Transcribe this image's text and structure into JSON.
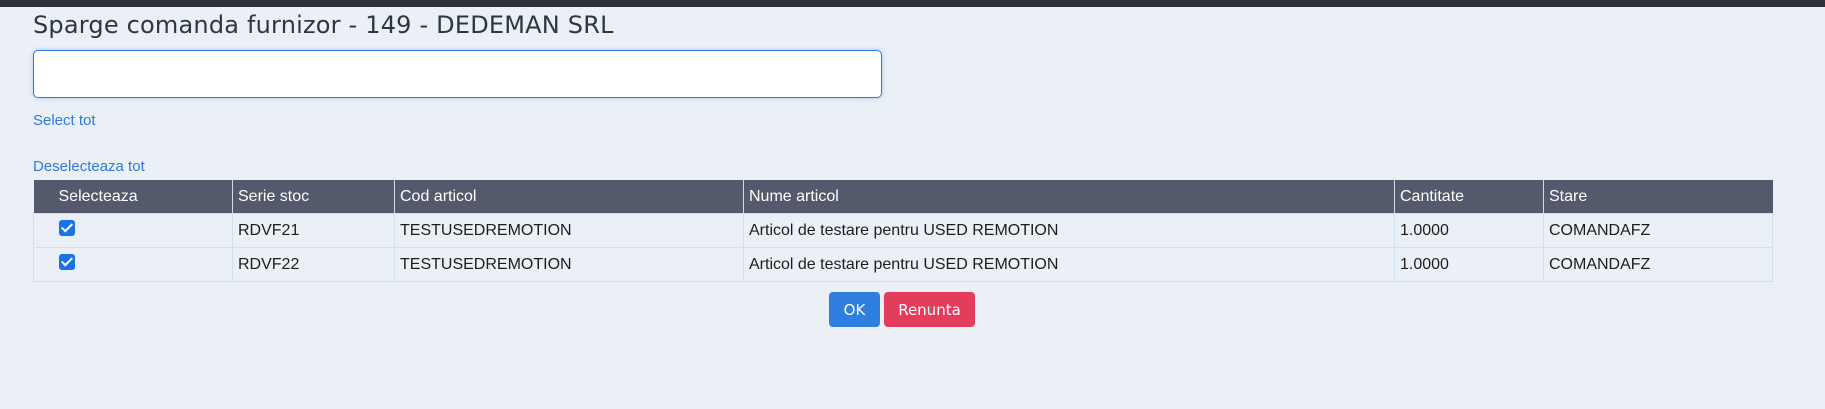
{
  "page": {
    "title": "Sparge comanda furnizor - 149 - DEDEMAN SRL"
  },
  "search": {
    "value": "",
    "placeholder": ""
  },
  "links": {
    "select_all": "Select tot",
    "deselect_all": "Deselecteaza tot"
  },
  "table": {
    "columns": [
      "Selecteaza",
      "Serie stoc",
      "Cod articol",
      "Nume articol",
      "Cantitate",
      "Stare"
    ],
    "rows": [
      {
        "selected": true,
        "serie_stoc": "RDVF21",
        "cod_articol": "TESTUSEDREMOTION",
        "nume_articol": "Articol de testare pentru USED REMOTION",
        "cantitate": "1.0000",
        "stare": "COMANDAFZ"
      },
      {
        "selected": true,
        "serie_stoc": "RDVF22",
        "cod_articol": "TESTUSEDREMOTION",
        "nume_articol": "Articol de testare pentru USED REMOTION",
        "cantitate": "1.0000",
        "stare": "COMANDAFZ"
      }
    ]
  },
  "buttons": {
    "ok": "OK",
    "cancel": "Renunta"
  },
  "colors": {
    "accent": "#2f7bdc",
    "header_bg": "#545a6b",
    "danger": "#e33d5b",
    "page_bg": "#ebf0f7"
  }
}
